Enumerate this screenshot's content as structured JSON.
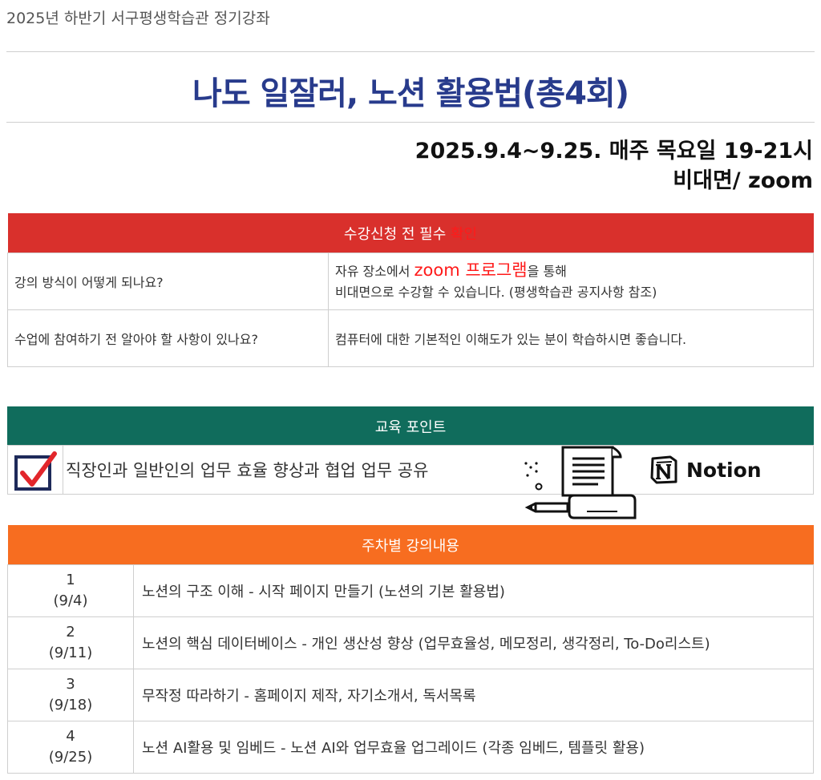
{
  "header": {
    "subtitle": "2025년 하반기 서구평생학습관 정기강좌",
    "title": "나도 일잘러, 노션 활용법(총4회)",
    "date_line": "2025.9.4~9.25. 매주 목요일 19-21시",
    "mode_line": "비대면/ zoom"
  },
  "notice": {
    "header_main": "수강신청 전 필수 ",
    "header_highlight": "확인",
    "rows": [
      {
        "question": "강의 방식이 어떻게 되나요?",
        "answer_line1_pre": "자유 장소에서 ",
        "answer_line1_highlight": "zoom 프로그램",
        "answer_line1_post": "을 통해",
        "answer_line2": "비대면으로 수강할 수 있습니다. (평생학습관 공지사항 참조)"
      },
      {
        "question": "수업에 참여하기 전 알아야 할 사항이 있나요?",
        "answer": "컴퓨터에 대한 기본적인 이해도가 있는 분이 학습하시면 좋습니다."
      }
    ]
  },
  "edu_point": {
    "header": "교육 포인트",
    "text": "직장인과 일반인의 업무 효율 향상과 협업 업무 공유",
    "brand": "Notion",
    "icons": [
      "checkbox-checked-icon",
      "document-pen-icon",
      "notion-logo-icon"
    ]
  },
  "schedule": {
    "header": "주차별 강의내용",
    "weeks": [
      {
        "num": "1",
        "date": "(9/4)",
        "content": "노션의 구조 이해 - 시작 페이지 만들기 (노션의 기본 활용법)"
      },
      {
        "num": "2",
        "date": "(9/11)",
        "content": "노션의 핵심 데이터베이스 - 개인 생산성 향상 (업무효율성, 메모정리, 생각정리, To-Do리스트)"
      },
      {
        "num": "3",
        "date": "(9/18)",
        "content": "무작정 따라하기 - 홈페이지 제작, 자기소개서, 독서목록"
      },
      {
        "num": "4",
        "date": "(9/25)",
        "content": "노션 AI활용 및 임베드 - 노션 AI와 업무효율 업그레이드 (각종 임베드, 템플릿 활용)"
      }
    ]
  },
  "colors": {
    "title": "#283b8c",
    "notice_header": "#d9302c",
    "point_header": "#106c5c",
    "schedule_header": "#f76d20",
    "highlight": "#ff1a1a"
  }
}
